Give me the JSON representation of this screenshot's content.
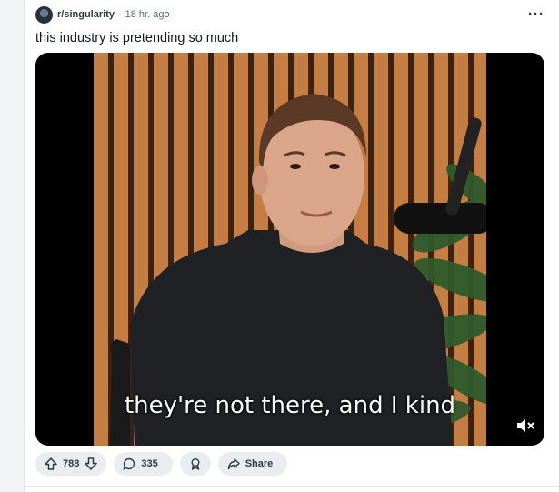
{
  "post": {
    "subreddit": "r/singularity",
    "separator": "·",
    "age": "18 hr. ago",
    "title": "this industry is pretending so much",
    "more_label": "···"
  },
  "video": {
    "caption": "they're not there, and I kind",
    "muted": true
  },
  "actions": {
    "upvotes": "788",
    "comments": "335",
    "share_label": "Share"
  },
  "icons": [
    "subreddit-avatar-icon",
    "more-options-icon",
    "mute-icon",
    "upvote-icon",
    "downvote-icon",
    "comment-icon",
    "award-icon",
    "share-icon"
  ]
}
